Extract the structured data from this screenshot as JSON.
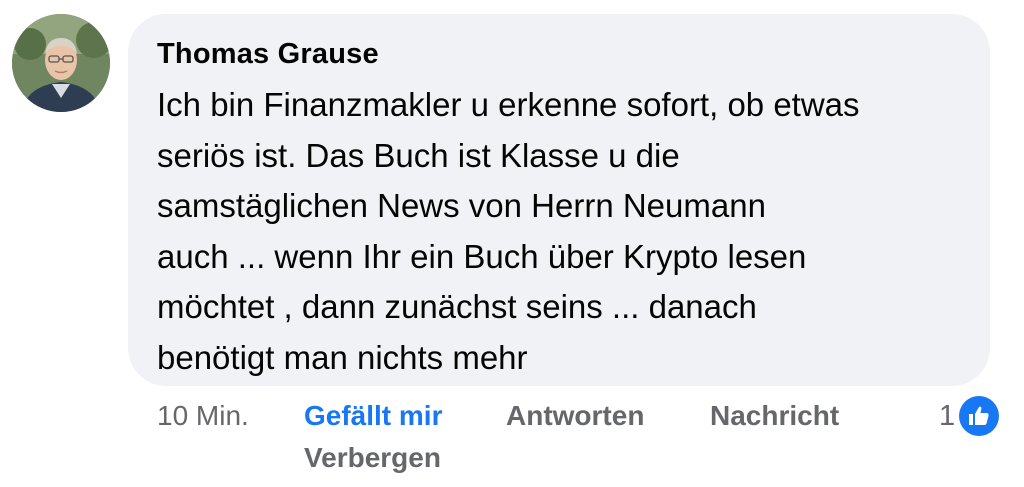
{
  "comment": {
    "author": "Thomas Grause",
    "text_lines": [
      "Ich bin Finanzmakler u erkenne sofort, ob etwas",
      "seriös ist. Das Buch ist Klasse u die",
      "samstäglichen News von Herrn Neumann",
      "auch ... wenn Ihr ein Buch über Krypto lesen",
      "möchtet , dann zunächst seins ... danach",
      "benötigt man nichts mehr"
    ],
    "avatar_icon": "profile-photo"
  },
  "actions": {
    "time": "10 Min.",
    "like_label": "Gefällt mir",
    "reply_label": "Antworten",
    "message_label": "Nachricht",
    "hide_label": "Verbergen"
  },
  "reactions": {
    "count": "1",
    "icon": "thumbs-up-icon",
    "color": "#1877f2"
  },
  "colors": {
    "bubble": "#f0f2f5",
    "text": "#050505",
    "muted": "#65676b",
    "accent": "#1877f2"
  }
}
